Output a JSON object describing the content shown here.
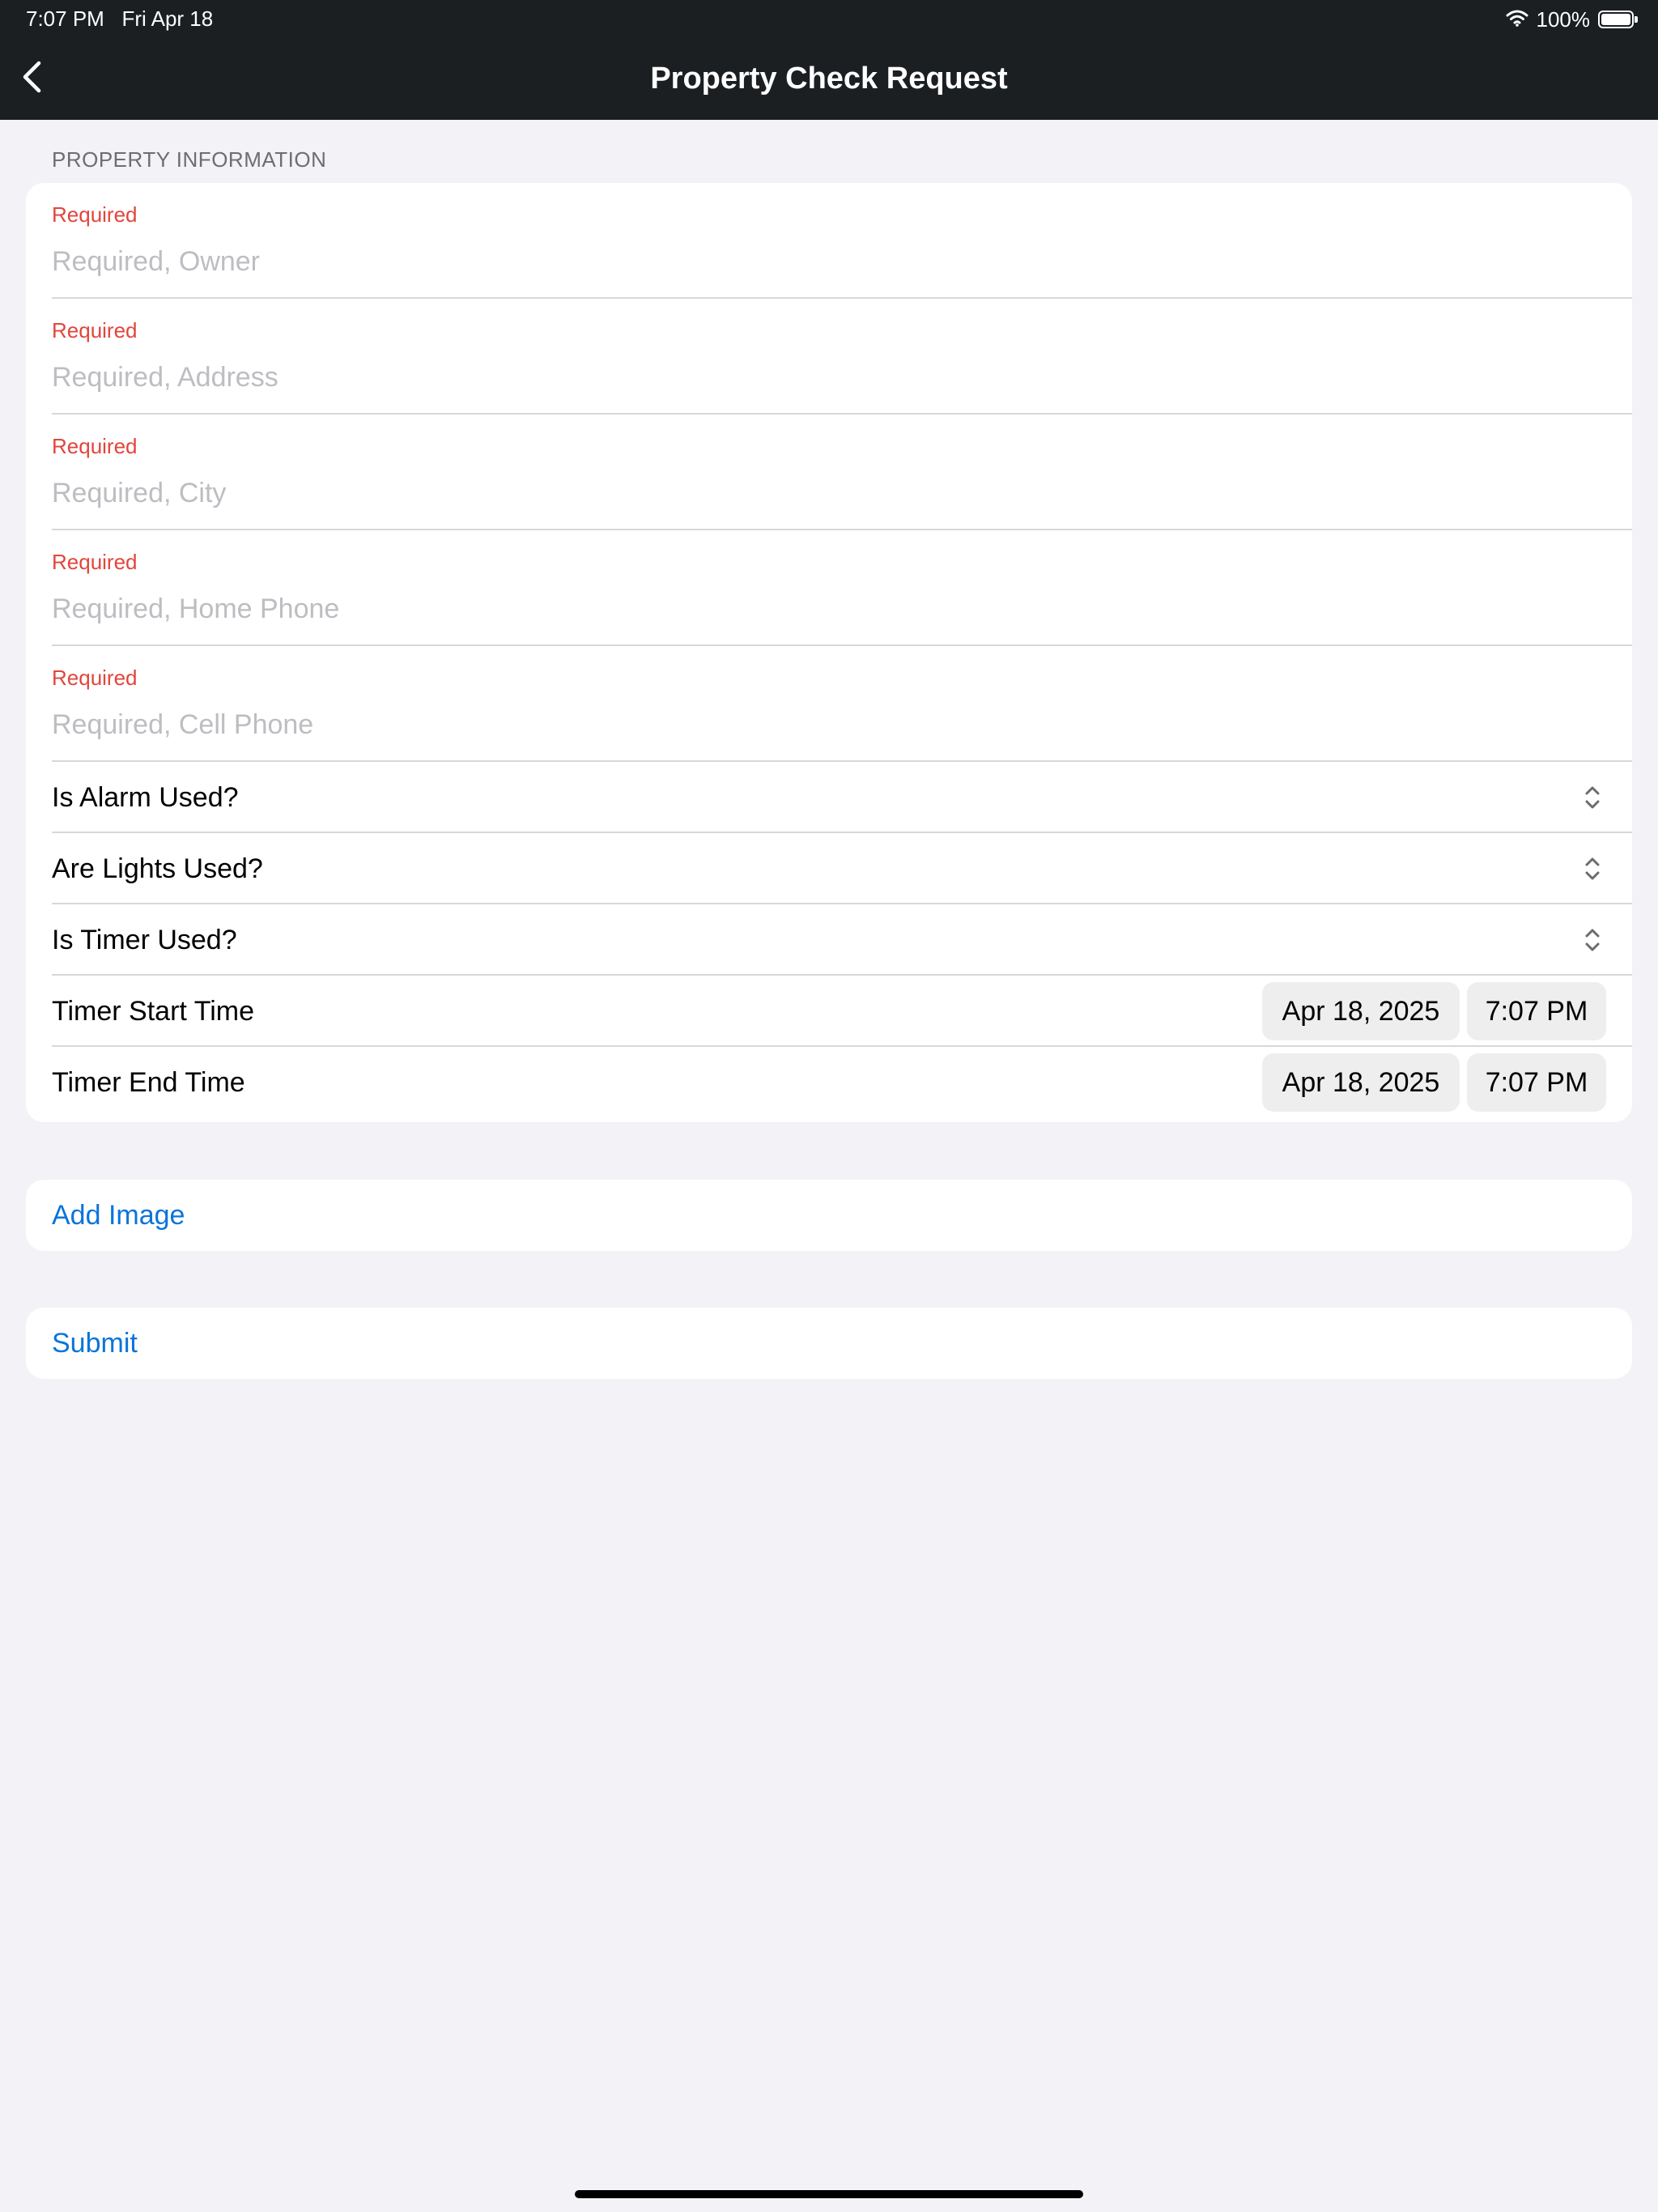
{
  "status_bar": {
    "time": "7:07 PM",
    "date": "Fri Apr 18",
    "battery": "100%",
    "icons": [
      "wifi-icon",
      "battery-icon"
    ]
  },
  "nav": {
    "title": "Property Check Request",
    "back_icon": "chevron-left-icon"
  },
  "form": {
    "section_header": "PROPERTY INFORMATION",
    "text_fields": [
      {
        "label": "Required",
        "placeholder": "Required, Owner",
        "value": ""
      },
      {
        "label": "Required",
        "placeholder": "Required, Address",
        "value": ""
      },
      {
        "label": "Required",
        "placeholder": "Required, City",
        "value": ""
      },
      {
        "label": "Required",
        "placeholder": "Required, Home Phone",
        "value": ""
      },
      {
        "label": "Required",
        "placeholder": "Required, Cell Phone",
        "value": ""
      }
    ],
    "pickers": [
      {
        "label": "Is Alarm Used?",
        "icon": "chevron-up-down-icon"
      },
      {
        "label": "Are Lights Used?",
        "icon": "chevron-up-down-icon"
      },
      {
        "label": "Is Timer Used?",
        "icon": "chevron-up-down-icon"
      }
    ],
    "date_rows": [
      {
        "label": "Timer Start Time",
        "date": "Apr 18, 2025",
        "time": "7:07 PM"
      },
      {
        "label": "Timer End Time",
        "date": "Apr 18, 2025",
        "time": "7:07 PM"
      }
    ]
  },
  "actions": {
    "add_image": "Add Image",
    "submit": "Submit"
  },
  "colors": {
    "nav_background": "#1C1F22",
    "page_background": "#F2F2F7",
    "required_label": "#E2453C",
    "accent_link": "#0A74DA",
    "placeholder": "#BDBDC2"
  }
}
